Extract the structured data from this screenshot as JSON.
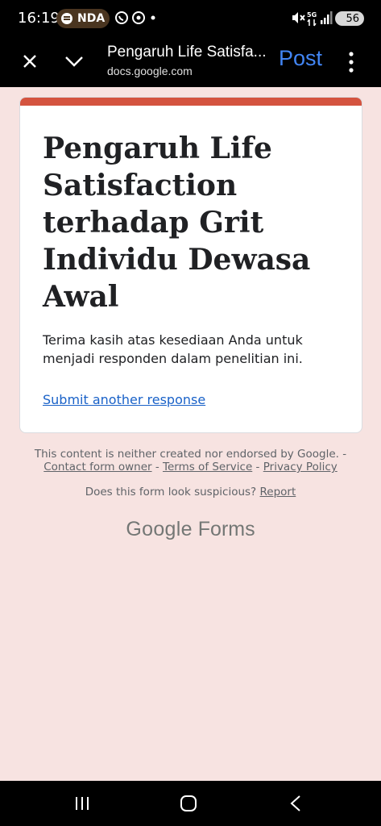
{
  "status_bar": {
    "time": "16:19",
    "pill_label": "NDA",
    "network": "5G",
    "battery": "56"
  },
  "header": {
    "title": "Pengaruh Life Satisfa...",
    "url": "docs.google.com",
    "post_label": "Post"
  },
  "card": {
    "accent_color": "#d4533f",
    "title": "Pengaruh Life Satisfaction terhadap Grit Individu Dewasa Awal",
    "message": "Terima kasih atas kesediaan Anda untuk menjadi responden dalam penelitian ini.",
    "link_label": "Submit another response"
  },
  "footer": {
    "disclaimer": "This content is neither created nor endorsed by Google. -",
    "contact": "Contact form owner",
    "sep1": " - ",
    "terms": "Terms of Service",
    "sep2": " - ",
    "privacy": "Privacy Policy",
    "suspicious_text": "Does this form look suspicious?",
    "report": "Report",
    "brand_google": "Google",
    "brand_forms": "Forms"
  }
}
